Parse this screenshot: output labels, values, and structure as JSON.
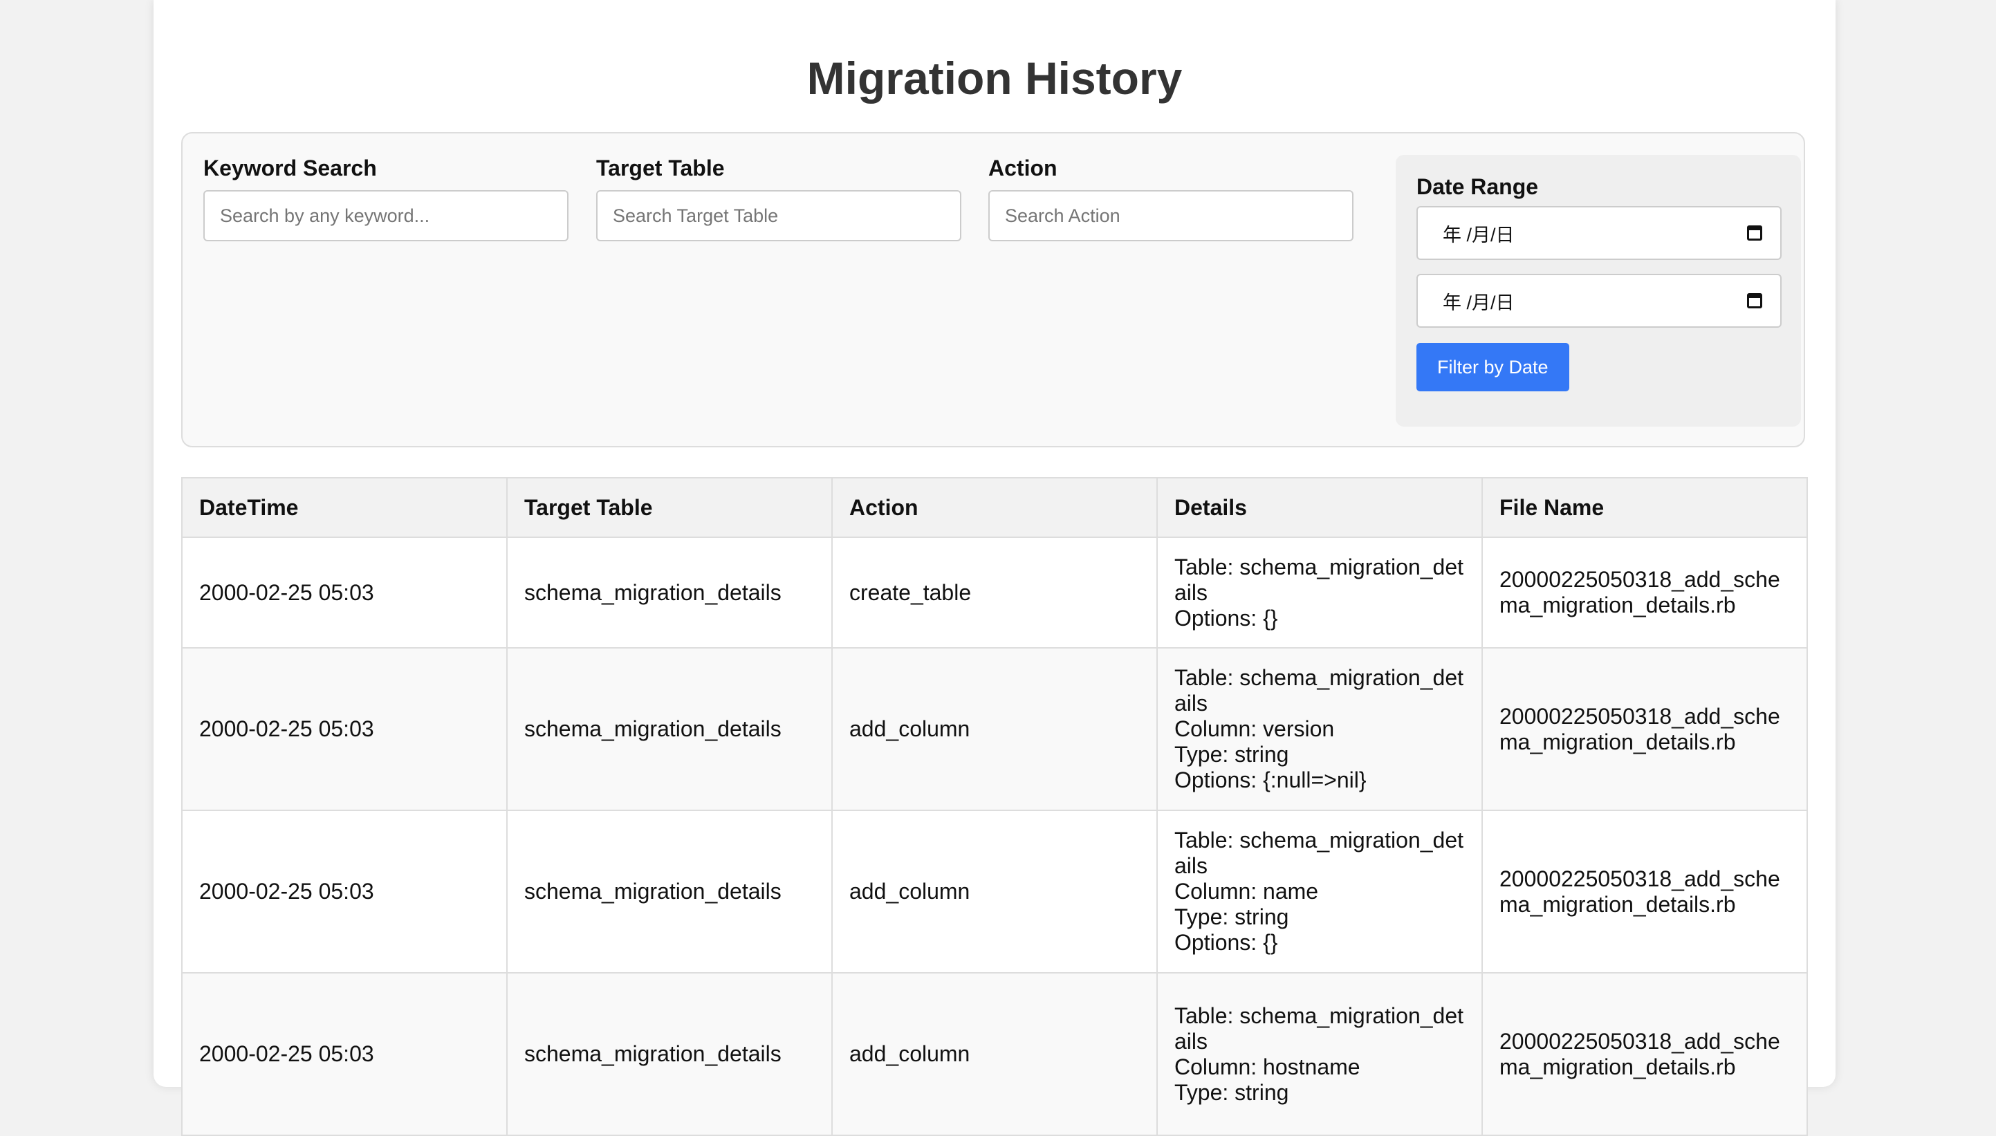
{
  "page": {
    "title": "Migration History"
  },
  "filters": {
    "keyword": {
      "label": "Keyword Search",
      "placeholder": "Search by any keyword..."
    },
    "target_table": {
      "label": "Target Table",
      "placeholder": "Search Target Table"
    },
    "action": {
      "label": "Action",
      "placeholder": "Search Action"
    },
    "date_range": {
      "label": "Date Range",
      "start_display": "年 /月/日",
      "end_display": "年 /月/日",
      "button_label": "Filter by Date"
    }
  },
  "table": {
    "headers": [
      "DateTime",
      "Target Table",
      "Action",
      "Details",
      "File Name"
    ],
    "rows": [
      {
        "datetime": "2000-02-25 05:03",
        "target_table": "schema_migration_details",
        "action": "create_table",
        "details": [
          "Table: schema_migration_details",
          "Options: {}"
        ],
        "file_name": "20000225050318_add_schema_migration_details.rb"
      },
      {
        "datetime": "2000-02-25 05:03",
        "target_table": "schema_migration_details",
        "action": "add_column",
        "details": [
          "Table: schema_migration_details",
          "Column: version",
          "Type: string",
          "Options: {:null=>nil}"
        ],
        "file_name": "20000225050318_add_schema_migration_details.rb"
      },
      {
        "datetime": "2000-02-25 05:03",
        "target_table": "schema_migration_details",
        "action": "add_column",
        "details": [
          "Table: schema_migration_details",
          "Column: name",
          "Type: string",
          "Options: {}"
        ],
        "file_name": "20000225050318_add_schema_migration_details.rb"
      },
      {
        "datetime": "2000-02-25 05:03",
        "target_table": "schema_migration_details",
        "action": "add_column",
        "details": [
          "Table: schema_migration_details",
          "Column: hostname",
          "Type: string"
        ],
        "file_name": "20000225050318_add_schema_migration_details.rb"
      }
    ]
  },
  "colors": {
    "accent": "#3478f6",
    "background": "#f2f2f2",
    "panel": "#f9f9f9",
    "border": "#dddddd"
  },
  "icons": [
    "calendar-icon"
  ]
}
